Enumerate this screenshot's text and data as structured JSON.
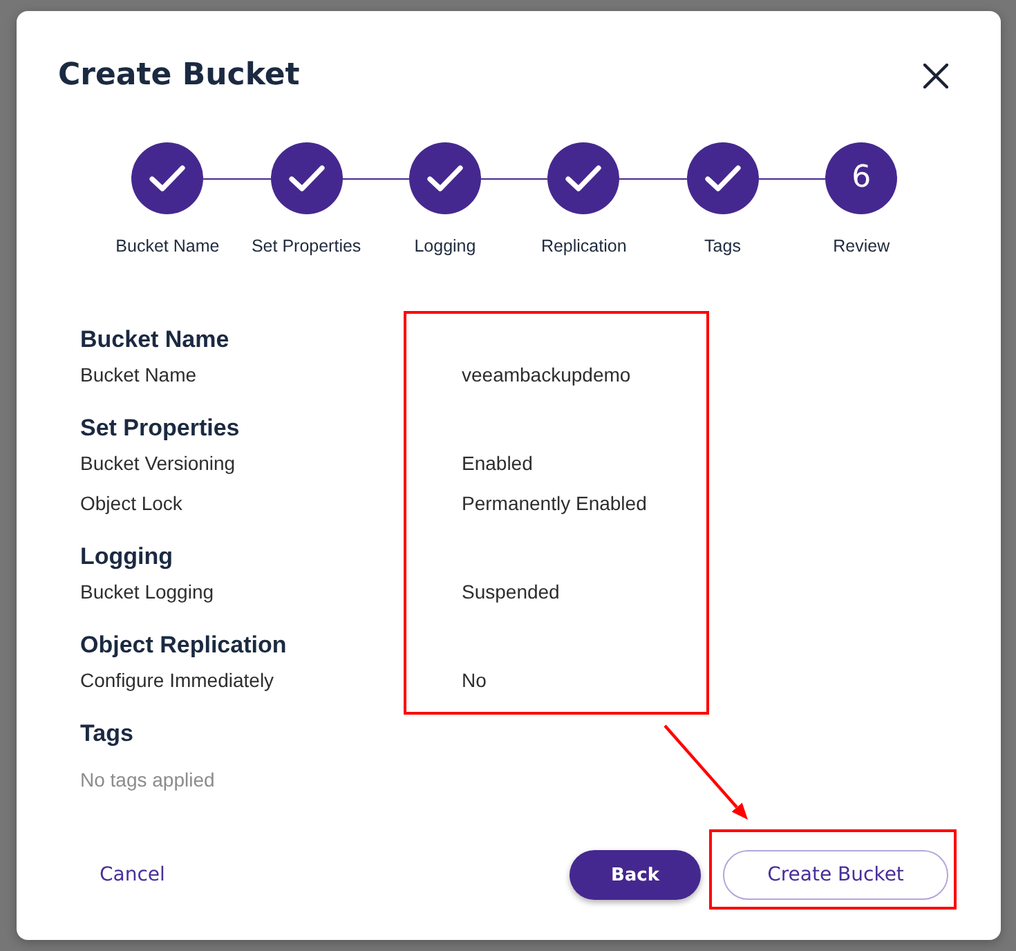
{
  "dialog": {
    "title": "Create Bucket"
  },
  "steps": [
    {
      "label": "Bucket Name",
      "completed": true
    },
    {
      "label": "Set Properties",
      "completed": true
    },
    {
      "label": "Logging",
      "completed": true
    },
    {
      "label": "Replication",
      "completed": true
    },
    {
      "label": "Tags",
      "completed": true
    },
    {
      "label": "Review",
      "completed": false,
      "number": "6"
    }
  ],
  "sections": [
    {
      "title": "Bucket Name",
      "rows": [
        {
          "label": "Bucket Name",
          "value": "veeambackupdemo"
        }
      ]
    },
    {
      "title": "Set Properties",
      "rows": [
        {
          "label": "Bucket Versioning",
          "value": "Enabled"
        },
        {
          "label": "Object Lock",
          "value": "Permanently Enabled"
        }
      ]
    },
    {
      "title": "Logging",
      "rows": [
        {
          "label": "Bucket Logging",
          "value": "Suspended"
        }
      ]
    },
    {
      "title": "Object Replication",
      "rows": [
        {
          "label": "Configure Immediately",
          "value": "No"
        }
      ]
    },
    {
      "title": "Tags",
      "note": "No tags applied"
    }
  ],
  "buttons": [
    {
      "label": "Cancel",
      "kind": "link"
    },
    {
      "label": "Back",
      "kind": "primary"
    },
    {
      "label": "Create Bucket",
      "kind": "secondary"
    }
  ]
}
